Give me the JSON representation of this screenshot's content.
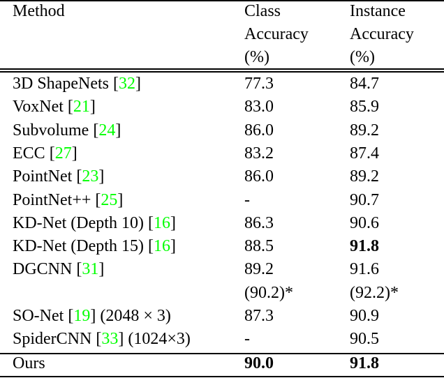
{
  "table": {
    "headers": {
      "method": [
        "Method"
      ],
      "class_accuracy": [
        "Class",
        "Accuracy",
        "(%)"
      ],
      "instance_accuracy": [
        "Instance",
        "Accuracy",
        "(%)"
      ]
    },
    "citation_color": "#00ff00",
    "rows": [
      {
        "method": "3D ShapeNets",
        "cite": "32",
        "suffix": "",
        "class_acc": "77.3",
        "instance_acc": "84.7"
      },
      {
        "method": "VoxNet",
        "cite": "21",
        "suffix": "",
        "class_acc": "83.0",
        "instance_acc": "85.9"
      },
      {
        "method": "Subvolume",
        "cite": "24",
        "suffix": "",
        "class_acc": "86.0",
        "instance_acc": "89.2"
      },
      {
        "method": "ECC",
        "cite": "27",
        "suffix": "",
        "class_acc": "83.2",
        "instance_acc": "87.4"
      },
      {
        "method": "PointNet",
        "cite": "23",
        "suffix": "",
        "class_acc": "86.0",
        "instance_acc": "89.2"
      },
      {
        "method": "PointNet++",
        "cite": "25",
        "suffix": "",
        "class_acc": "-",
        "instance_acc": "90.7"
      },
      {
        "method": "KD-Net (Depth 10)",
        "cite": "16",
        "suffix": "",
        "class_acc": "86.3",
        "instance_acc": "90.6"
      },
      {
        "method": "KD-Net (Depth 15)",
        "cite": "16",
        "suffix": "",
        "class_acc": "88.5",
        "instance_acc": "91.8",
        "instance_bold": true
      },
      {
        "method": "DGCNN",
        "cite": "31",
        "suffix": "",
        "class_acc": "89.2",
        "instance_acc": "91.6"
      },
      {
        "method": "",
        "cite": "",
        "suffix": "",
        "class_acc": "(90.2)*",
        "instance_acc": "(92.2)*"
      },
      {
        "method": "SO-Net",
        "cite": "19",
        "suffix": " (2048 × 3)",
        "class_acc": "87.3",
        "instance_acc": "90.9"
      },
      {
        "method": "SpiderCNN",
        "cite": "33",
        "suffix": " (1024×3)",
        "class_acc": "-",
        "instance_acc": "90.5"
      }
    ],
    "ours": {
      "method": "Ours",
      "class_acc": "90.0",
      "instance_acc": "91.8"
    }
  }
}
